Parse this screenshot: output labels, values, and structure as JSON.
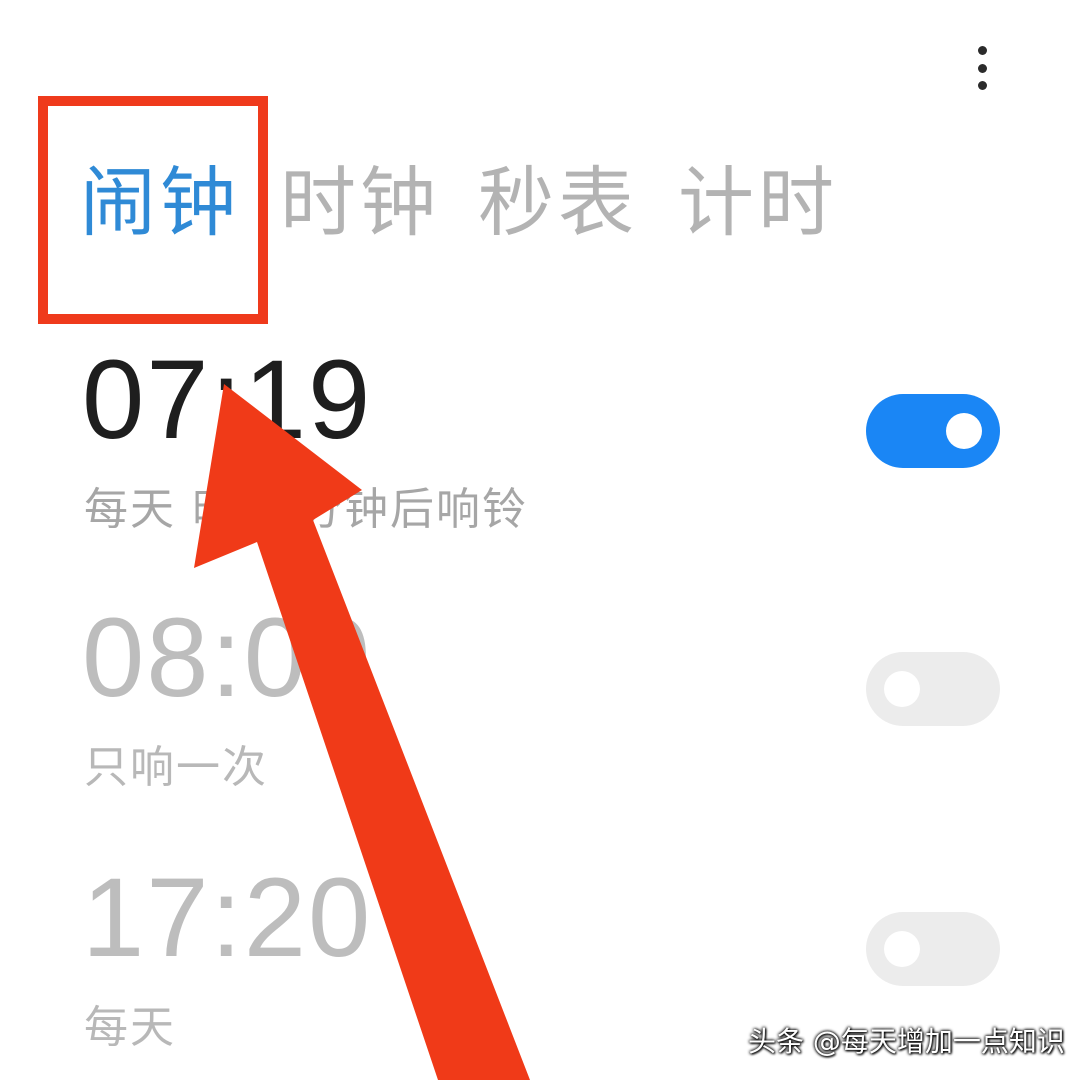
{
  "tabs": [
    {
      "label": "闹钟",
      "active": true
    },
    {
      "label": "时钟",
      "active": false
    },
    {
      "label": "秒表",
      "active": false
    },
    {
      "label": "计时",
      "active": false
    }
  ],
  "alarms": [
    {
      "time": "07:19",
      "repeat": "每天  时37分钟后响铃",
      "enabled": true
    },
    {
      "time": "08:00",
      "repeat": "只响一次",
      "enabled": false
    },
    {
      "time": "17:20",
      "repeat": "每天",
      "enabled": false
    }
  ],
  "watermark": "头条 @每天增加一点知识",
  "icons": {
    "menu": "more-vert-icon"
  },
  "colors": {
    "active_tab": "#2f8ad6",
    "inactive_tab": "#b3b3b3",
    "toggle_on": "#1a86f5",
    "toggle_off": "#ececec",
    "annotation": "#ef3a1c"
  }
}
